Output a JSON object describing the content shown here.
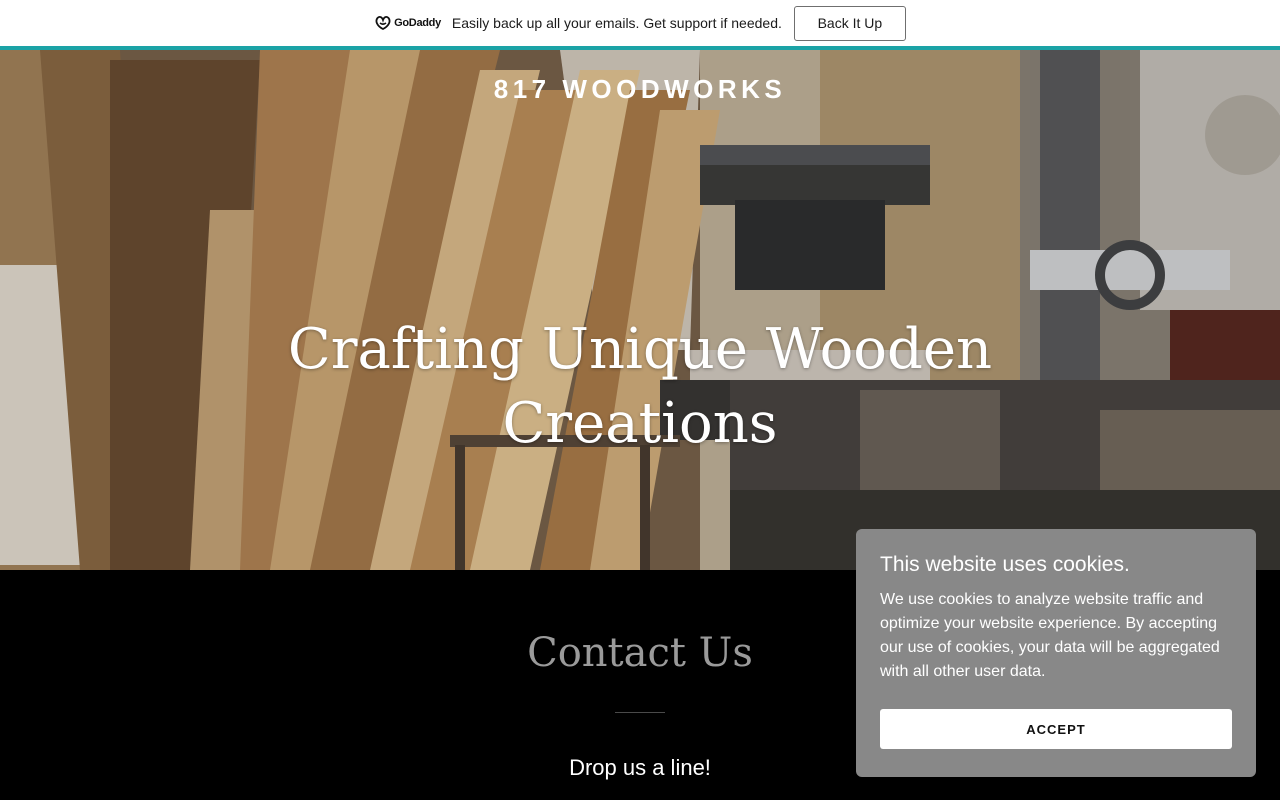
{
  "promo": {
    "logo_text": "GoDaddy",
    "message": "Easily back up all your emails. Get support if needed.",
    "button_label": "Back It Up",
    "accent_color": "#1ba3a6"
  },
  "hero": {
    "brand": "817 WOODWORKS",
    "headline": "Crafting Unique Wooden Creations"
  },
  "contact": {
    "title": "Contact Us",
    "subtitle": "Drop us a line!"
  },
  "cookie_banner": {
    "title": "This website uses cookies.",
    "body": "We use cookies to analyze website traffic and optimize your website experience. By accepting our use of cookies, your data will be aggregated with all other user data.",
    "accept_label": "ACCEPT"
  }
}
